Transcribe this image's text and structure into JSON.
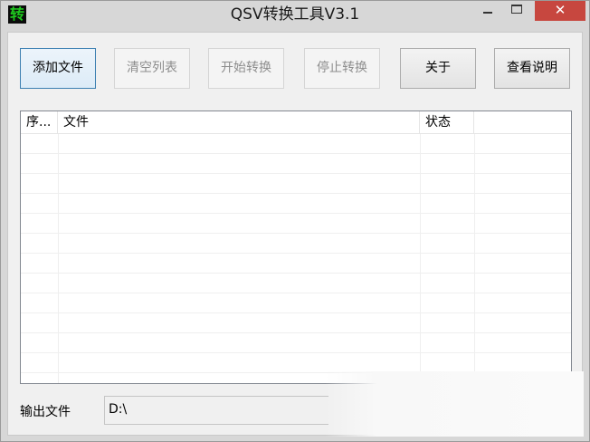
{
  "window": {
    "title": "QSV转换工具V3.1",
    "icon_char": "转",
    "controls": {
      "minimize": "minimize-icon",
      "maximize": "maximize-icon",
      "close": "✕"
    }
  },
  "toolbar": {
    "add_file": "添加文件",
    "clear_list": "清空列表",
    "start_convert": "开始转换",
    "stop_convert": "停止转换",
    "about": "关于",
    "view_help": "查看说明"
  },
  "list": {
    "columns": [
      "序...",
      "文件",
      "状态",
      ""
    ],
    "rows": []
  },
  "output": {
    "label": "输出文件",
    "value": "D:\\"
  },
  "colors": {
    "close_button": "#c7473f",
    "primary_border": "#3c7fb1",
    "app_icon_fg": "#1ec81e"
  }
}
